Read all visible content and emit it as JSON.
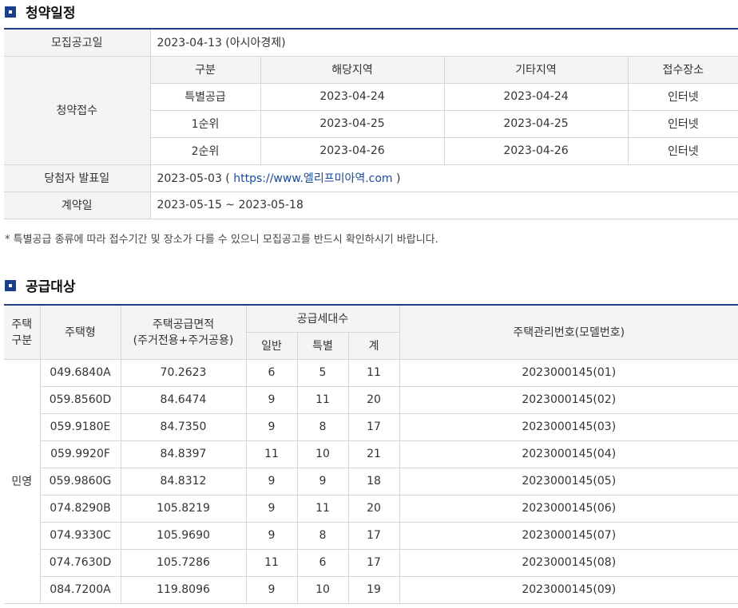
{
  "schedule": {
    "title": "청약일정",
    "notice_label": "모집공고일",
    "notice_value": "2023-04-13 (아시아경제)",
    "apply_label": "청약접수",
    "apply_headers": [
      "구분",
      "해당지역",
      "기타지역",
      "접수장소"
    ],
    "apply_rows": [
      [
        "특별공급",
        "2023-04-24",
        "2023-04-24",
        "인터넷"
      ],
      [
        "1순위",
        "2023-04-25",
        "2023-04-25",
        "인터넷"
      ],
      [
        "2순위",
        "2023-04-26",
        "2023-04-26",
        "인터넷"
      ]
    ],
    "winner_label": "당첨자 발표일",
    "winner_date": "2023-05-03 (",
    "winner_url": "https://www.엘리프미아역.com",
    "winner_close": ")",
    "contract_label": "계약일",
    "contract_value": "2023-05-15 ~ 2023-05-18",
    "note": "* 특별공급 종류에 따라 접수기간 및 장소가 다를 수 있으니 모집공고를 반드시 확인하시기 바랍니다."
  },
  "supply": {
    "title": "공급대상",
    "h_house_type1": "주택",
    "h_house_type2": "구분",
    "h_type": "주택형",
    "h_area1": "주택공급면적",
    "h_area2": "(주거전용+주거공용)",
    "h_units": "공급세대수",
    "h_general": "일반",
    "h_special": "특별",
    "h_total": "계",
    "h_model": "주택관리번호(모델번호)",
    "category": "민영",
    "rows": [
      [
        "049.6840A",
        "70.2623",
        "6",
        "5",
        "11",
        "2023000145(01)"
      ],
      [
        "059.8560D",
        "84.6474",
        "9",
        "11",
        "20",
        "2023000145(02)"
      ],
      [
        "059.9180E",
        "84.7350",
        "9",
        "8",
        "17",
        "2023000145(03)"
      ],
      [
        "059.9920F",
        "84.8397",
        "11",
        "10",
        "21",
        "2023000145(04)"
      ],
      [
        "059.9860G",
        "84.8312",
        "9",
        "9",
        "18",
        "2023000145(05)"
      ],
      [
        "074.8290B",
        "105.8219",
        "9",
        "11",
        "20",
        "2023000145(06)"
      ],
      [
        "074.9330C",
        "105.9690",
        "9",
        "8",
        "17",
        "2023000145(07)"
      ],
      [
        "074.7630D",
        "105.7286",
        "11",
        "6",
        "17",
        "2023000145(08)"
      ],
      [
        "084.7200A",
        "119.8096",
        "9",
        "10",
        "19",
        "2023000145(09)"
      ]
    ]
  }
}
